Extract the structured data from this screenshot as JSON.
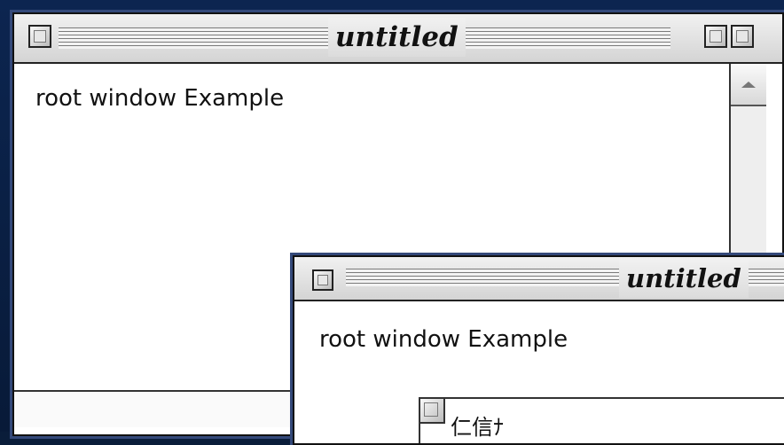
{
  "windows": [
    {
      "title": "untitled",
      "content": "root window Example"
    },
    {
      "title": "untitled",
      "content": "root window Example",
      "text_field_value": "仁信ﾅ"
    }
  ],
  "colors": {
    "desktop": "#0c2550",
    "window_outline": "#34497a",
    "titlebar": "#dcdcdc",
    "content_bg": "#ffffff"
  },
  "icons": {
    "close": "close-box-icon",
    "zoom": "zoom-box-icon",
    "collapse": "collapse-box-icon",
    "scroll_up": "scroll-up-arrow-icon"
  }
}
